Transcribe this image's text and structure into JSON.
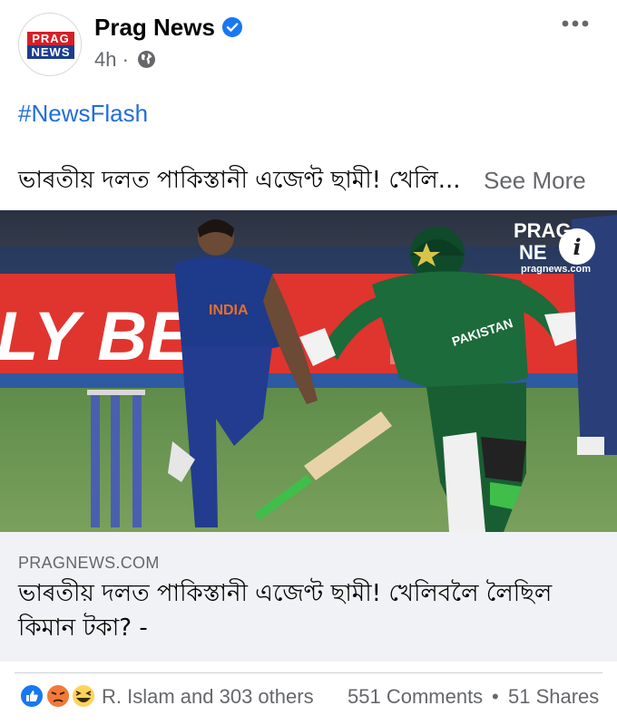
{
  "post": {
    "page_name": "Prag News",
    "avatar_logo_top": "PRAG",
    "avatar_logo_bottom": "NEWS",
    "time": "4h ·",
    "hashtag": "#NewsFlash",
    "caption": "ভাৰতীয় দলত পাকিস্তানী এজেণ্ট ছামী! খেলি...",
    "see_more": "See More"
  },
  "photo": {
    "banner_text": "LY BET",
    "shirt_india": "INDIA",
    "shirt_pakistan": "PAKISTAN",
    "watermark_line1": "PRAG",
    "watermark_line2": "NE",
    "watermark_site": "pragnews.com",
    "info_glyph": "i"
  },
  "link": {
    "domain": "PRAGNEWS.COM",
    "title": "ভাৰতীয় দলত পাকিস্তানী এজেণ্ট ছামী! খেলিবলৈ লৈছিল কিমান টকা? -"
  },
  "footer": {
    "reactions_text": "R. Islam and 303 others",
    "comments": "551 Comments",
    "separator": "•",
    "shares": "51 Shares"
  },
  "icons": {
    "verified": "verified-badge-icon",
    "globe": "globe-icon",
    "more": "more-options-icon",
    "like": "like-reaction-icon",
    "angry": "angry-reaction-icon",
    "haha": "haha-reaction-icon"
  },
  "colors": {
    "facebook_blue": "#1877f2",
    "hashtag_blue": "#216fdb",
    "secondary_text": "#65676b",
    "link_box_bg": "#f0f2f5",
    "brand_red": "#d42027"
  }
}
